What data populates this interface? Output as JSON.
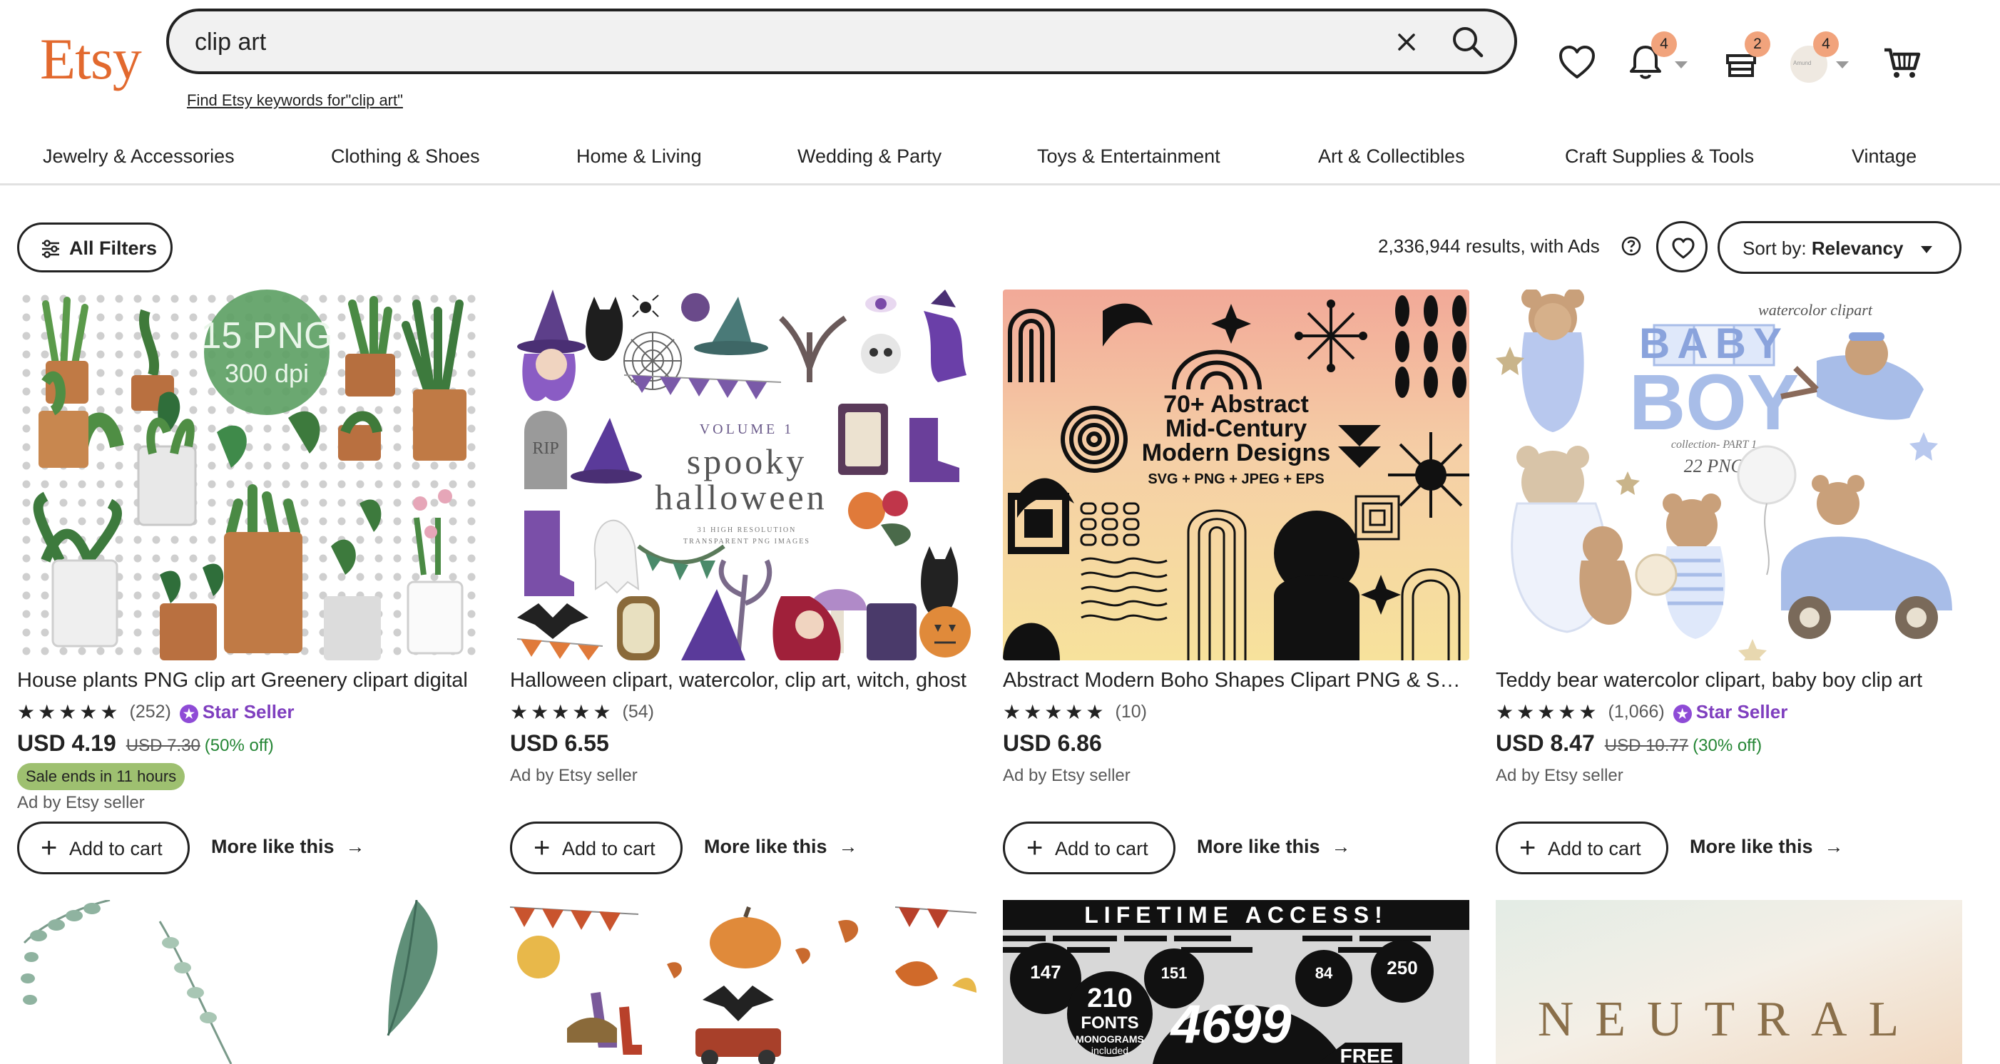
{
  "header": {
    "logo": "Etsy",
    "search_value": "clip art",
    "keywords_link": "Find Etsy keywords for\"clip art\"",
    "notifications_badge": "4",
    "cart_hub_badge": "2",
    "account_badge": "4",
    "avatar_text": "Amund"
  },
  "nav": {
    "categories": [
      "Jewelry & Accessories",
      "Clothing & Shoes",
      "Home & Living",
      "Wedding & Party",
      "Toys & Entertainment",
      "Art & Collectibles",
      "Craft Supplies & Tools",
      "Vintage"
    ]
  },
  "toolbar": {
    "filters_label": "All Filters",
    "results_text": "2,336,944 results, with Ads",
    "sort_prefix": "Sort by: ",
    "sort_value": "Relevancy"
  },
  "products": [
    {
      "title": "House plants PNG clip art Greenery clipart digital",
      "stars": "★★★★★",
      "count": "(252)",
      "star_seller": "Star Seller",
      "price": "USD 4.19",
      "original_price": "USD 7.30",
      "discount": "(50% off)",
      "sale_badge": "Sale ends in 11 hours",
      "ad": "Ad by Etsy seller",
      "cart_label": "Add to cart",
      "more_label": "More like this",
      "thumb_text_1": "15 PNG",
      "thumb_text_2": "300 dpi"
    },
    {
      "title": "Halloween clipart, watercolor, clip art, witch, ghost",
      "stars": "★★★★★",
      "count": "(54)",
      "price": "USD 6.55",
      "ad": "Ad by Etsy seller",
      "cart_label": "Add to cart",
      "more_label": "More like this",
      "thumb_text_1": "VOLUME 1",
      "thumb_text_2": "spooky",
      "thumb_text_3": "halloween",
      "thumb_text_4": "31 HIGH RESOLUTION",
      "thumb_text_5": "TRANSPARENT PNG IMAGES",
      "thumb_text_6": "RIP"
    },
    {
      "title": "Abstract Modern Boho Shapes Clipart PNG & SVG",
      "stars": "★★★★★",
      "count": "(10)",
      "price": "USD 6.86",
      "ad": "Ad by Etsy seller",
      "cart_label": "Add to cart",
      "more_label": "More like this",
      "thumb_text_1": "70+ Abstract",
      "thumb_text_2": "Mid-Century",
      "thumb_text_3": "Modern Designs",
      "thumb_text_4": "SVG + PNG + JPEG + EPS"
    },
    {
      "title": "Teddy bear watercolor clipart, baby boy clip art",
      "stars": "★★★★★",
      "count": "(1,066)",
      "star_seller": "Star Seller",
      "price": "USD 8.47",
      "original_price": "USD 10.77",
      "discount": "(30% off)",
      "ad": "Ad by Etsy seller",
      "cart_label": "Add to cart",
      "more_label": "More like this",
      "thumb_text_1": "watercolor clipart",
      "thumb_text_2": "BABY",
      "thumb_text_3": "BOY",
      "thumb_text_4": "collection- PART 1",
      "thumb_text_5": "22 PNG"
    }
  ],
  "row2": {
    "svg_banner": "LIFETIME ACCESS!",
    "svg_a": "210",
    "svg_b": "FONTS",
    "svg_c": "MONOGRAMS",
    "svg_d": "included",
    "svg_e": "4699",
    "svg_f": "FREE",
    "svg_g": "147",
    "svg_h": "151",
    "svg_i": "84",
    "svg_j": "250",
    "neutral": "NEUTRAL"
  }
}
